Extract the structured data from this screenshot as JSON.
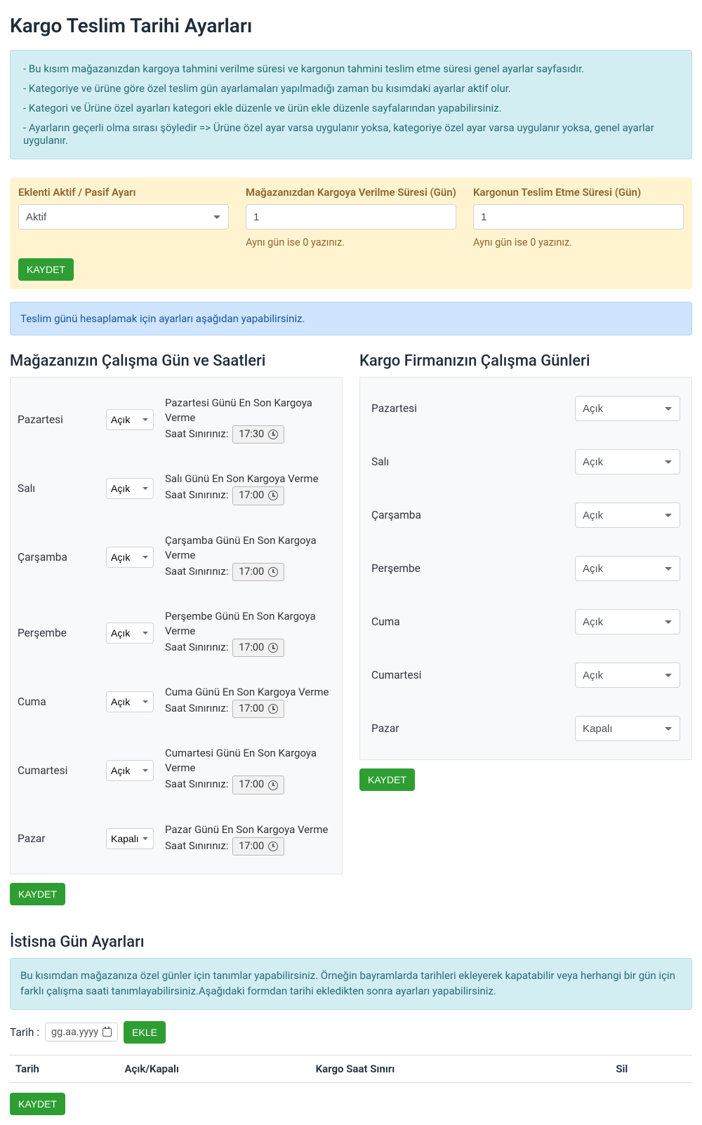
{
  "page": {
    "title": "Kargo Teslim Tarihi Ayarları"
  },
  "info_list": [
    "Bu kısım mağazanızdan kargoya tahmini verilme süresi ve kargonun tahmini teslim etme süresi genel ayarlar sayfasıdır.",
    "Kategoriye ve ürüne göre özel teslim gün ayarlamaları yapılmadığı zaman bu kısımdaki ayarlar aktif olur.",
    "Kategori ve Ürüne özel ayarları kategori ekle düzenle ve ürün ekle düzenle sayfalarından yapabilirsiniz.",
    "Ayarların geçerli olma sırası şöyledir => Ürüne özel ayar varsa uygulanır yoksa, kategoriye özel ayar varsa uygulanır yoksa, genel ayarlar uygulanır."
  ],
  "yellow": {
    "col1_label": "Eklenti Aktif / Pasif Ayarı",
    "col1_value": "Aktif",
    "col2_label": "Mağazanızdan Kargoya Verilme Süresi (Gün)",
    "col2_value": "1",
    "col2_hint": "Aynı gün ise 0 yazınız.",
    "col3_label": "Kargonun Teslim Etme Süresi (Gün)",
    "col3_value": "1",
    "col3_hint": "Aynı gün ise 0 yazınız.",
    "save": "KAYDET"
  },
  "info2": "Teslim günü hesaplamak için ayarları aşağıdan yapabilirsiniz.",
  "store_hours": {
    "title": "Mağazanızın Çalışma Gün ve Saatleri",
    "time_label": "Saat Sınırınız:",
    "days": [
      {
        "name": "Pazartesi",
        "status": "Açık",
        "text": "Pazartesi Günü En Son Kargoya Verme",
        "time": "17:30"
      },
      {
        "name": "Salı",
        "status": "Açık",
        "text": "Salı Günü En Son Kargoya Verme",
        "time": "17:00"
      },
      {
        "name": "Çarşamba",
        "status": "Açık",
        "text": "Çarşamba Günü En Son Kargoya Verme",
        "time": "17:00"
      },
      {
        "name": "Perşembe",
        "status": "Açık",
        "text": "Perşembe Günü En Son Kargoya Verme",
        "time": "17:00"
      },
      {
        "name": "Cuma",
        "status": "Açık",
        "text": "Cuma Günü En Son Kargoya Verme",
        "time": "17:00"
      },
      {
        "name": "Cumartesi",
        "status": "Açık",
        "text": "Cumartesi Günü En Son Kargoya Verme",
        "time": "17:00"
      },
      {
        "name": "Pazar",
        "status": "Kapalı",
        "text": "Pazar Günü En Son Kargoya Verme",
        "time": "17:00"
      }
    ],
    "save": "KAYDET"
  },
  "carrier_days": {
    "title": "Kargo Firmanızın Çalışma Günleri",
    "days": [
      {
        "name": "Pazartesi",
        "status": "Açık"
      },
      {
        "name": "Salı",
        "status": "Açık"
      },
      {
        "name": "Çarşamba",
        "status": "Açık"
      },
      {
        "name": "Perşembe",
        "status": "Açık"
      },
      {
        "name": "Cuma",
        "status": "Açık"
      },
      {
        "name": "Cumartesi",
        "status": "Açık"
      },
      {
        "name": "Pazar",
        "status": "Kapalı"
      }
    ],
    "save": "KAYDET"
  },
  "exceptions": {
    "title": "İstisna Gün Ayarları",
    "info": "Bu kısımdan mağazanıza özel günler için tanımlar yapabilirsiniz. Örneğin bayramlarda tarihleri ekleyerek kapatabilir veya herhangi bir gün için farklı çalışma saati tanımlayabilirsiniz.Aşağıdaki formdan tarihi ekledikten sonra ayarları yapabilirsiniz.",
    "date_label": "Tarih :",
    "date_placeholder": "gg.aa.yyyy",
    "add": "EKLE",
    "table": {
      "c1": "Tarih",
      "c2": "Açık/Kapalı",
      "c3": "Kargo Saat Sınırı",
      "c4": "Sil"
    },
    "save": "KAYDET"
  }
}
